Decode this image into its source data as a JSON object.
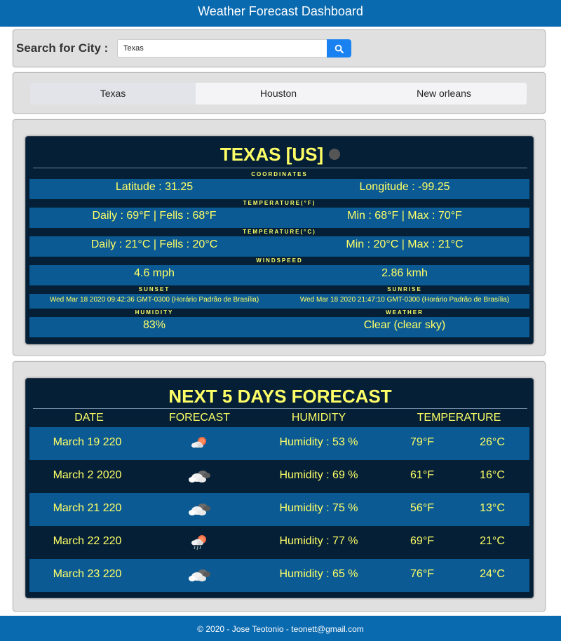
{
  "header": {
    "title": "Weather Forecast Dashboard"
  },
  "search": {
    "label": "Search for City :",
    "value": "Texas",
    "button_icon": "search-icon"
  },
  "tabs": [
    {
      "label": "Texas",
      "active": true
    },
    {
      "label": "Houston",
      "active": false
    },
    {
      "label": "New orleans",
      "active": false
    }
  ],
  "current": {
    "title": "TEXAS [US]",
    "condition_icon": "moon-icon",
    "coordinates_label": "COORDINATES",
    "latitude": "Latitude : 31.25",
    "longitude": "Longitude : -99.25",
    "temp_f_label": "TEMPERATURE(°F)",
    "temp_f_daily": "Daily : 69°F | Fells : 68°F",
    "temp_f_minmax": "Min : 68°F | Max : 70°F",
    "temp_c_label": "TEMPERATURE(°C)",
    "temp_c_daily": "Daily : 21°C | Fells : 20°C",
    "temp_c_minmax": "Min : 20°C | Max : 21°C",
    "wind_label": "WINDSPEED",
    "wind_mph": "4.6 mph",
    "wind_kmh": "2.86 kmh",
    "sunset_label": "SUNSET",
    "sunrise_label": "SUNRISE",
    "sunset": "Wed Mar 18 2020 09:42:36 GMT-0300 (Horário Padrão de Brasília)",
    "sunrise": "Wed Mar 18 2020 21:47:10 GMT-0300 (Horário Padrão de Brasília)",
    "humidity_label": "HUMIDITY",
    "weather_label": "WEATHER",
    "humidity": "83%",
    "weather": "Clear (clear sky)"
  },
  "forecast": {
    "title": "NEXT 5 DAYS FORECAST",
    "headers": {
      "date": "DATE",
      "forecast": "FORECAST",
      "humidity": "HUMIDITY",
      "temperature": "TEMPERATURE"
    },
    "days": [
      {
        "date": "March 19 220",
        "icon": "sun-cloud-icon",
        "humidity": "Humidity : 53 %",
        "temp_f": "79°F",
        "temp_c": "26°C"
      },
      {
        "date": "March 2 2020",
        "icon": "cloudy-icon",
        "humidity": "Humidity : 69 %",
        "temp_f": "61°F",
        "temp_c": "16°C"
      },
      {
        "date": "March 21 220",
        "icon": "cloudy-icon",
        "humidity": "Humidity : 75 %",
        "temp_f": "56°F",
        "temp_c": "13°C"
      },
      {
        "date": "March 22 220",
        "icon": "sun-rain-icon",
        "humidity": "Humidity : 77 %",
        "temp_f": "69°F",
        "temp_c": "21°C"
      },
      {
        "date": "March 23 220",
        "icon": "cloudy-icon",
        "humidity": "Humidity : 65 %",
        "temp_f": "76°F",
        "temp_c": "24°C"
      }
    ]
  },
  "footer": {
    "text": "© 2020 - Jose Teotonio - teonett@gmail.com"
  },
  "colors": {
    "brand": "#0a6aaf",
    "card_bg": "#041f36",
    "row_bg": "#0b5a93",
    "accent_text": "#ffff66",
    "search_button": "#1a82f0"
  }
}
